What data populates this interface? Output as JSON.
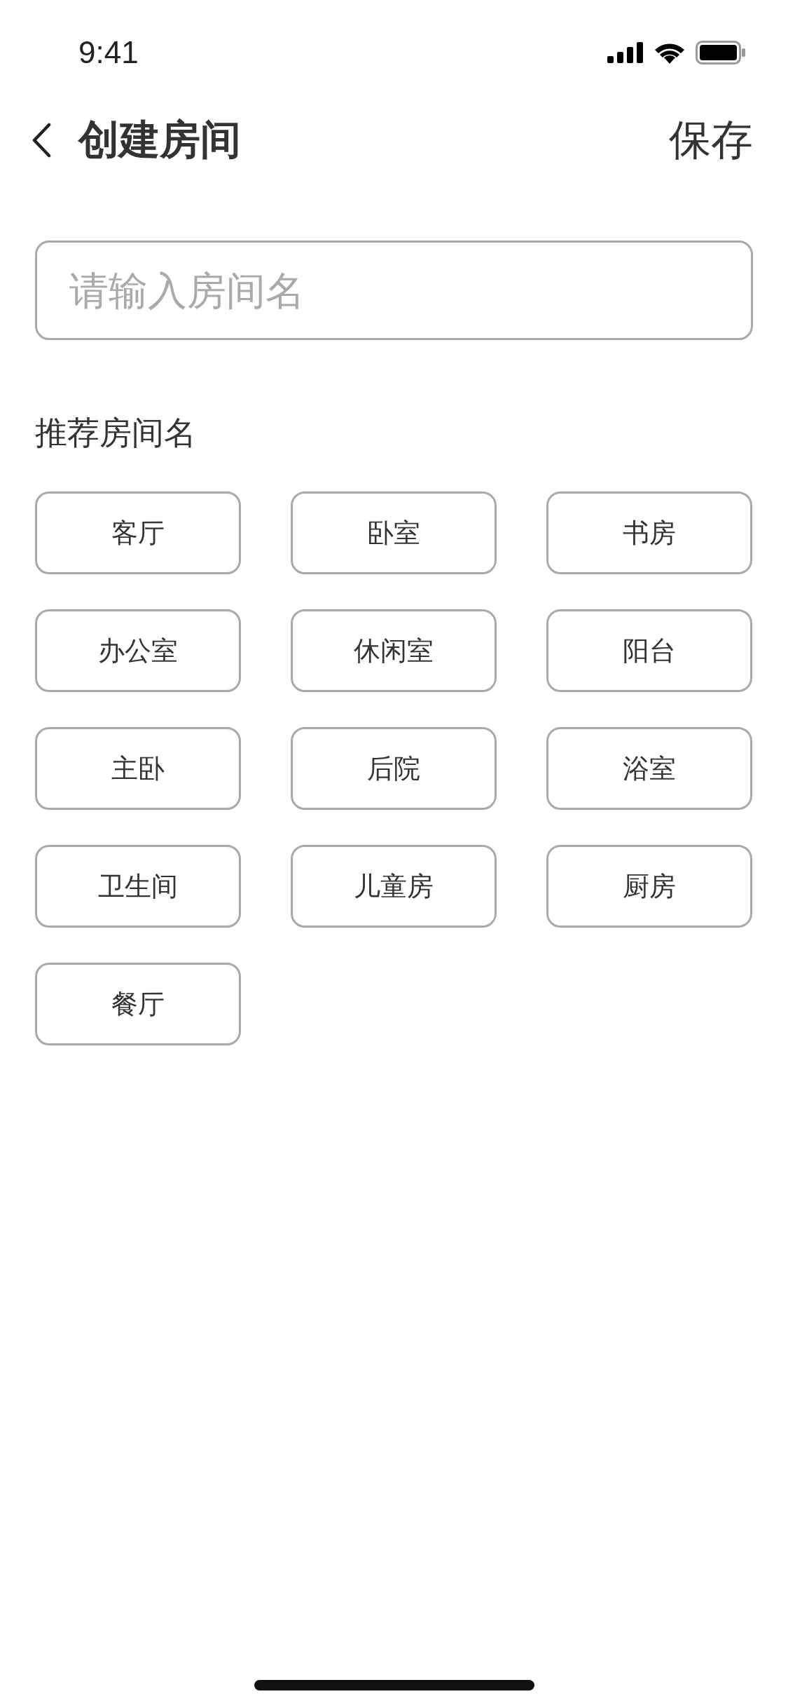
{
  "status_bar": {
    "time": "9:41"
  },
  "header": {
    "title": "创建房间",
    "action": "保存"
  },
  "name_field": {
    "placeholder": "请输入房间名"
  },
  "suggestions": {
    "label": "推荐房间名",
    "items": [
      "客厅",
      "卧室",
      "书房",
      "办公室",
      "休闲室",
      "阳台",
      "主卧",
      "后院",
      "浴室",
      "卫生间",
      "儿童房",
      "厨房",
      "餐厅"
    ]
  }
}
